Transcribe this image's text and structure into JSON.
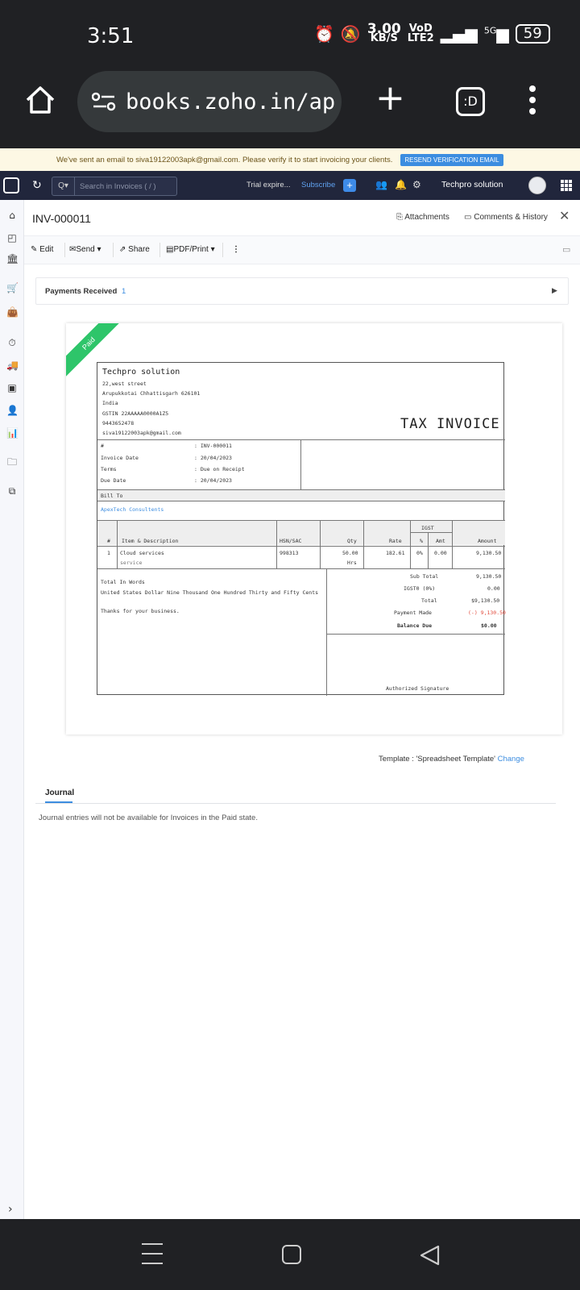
{
  "status_bar": {
    "time": "3:51",
    "net_speed_value": "3.00",
    "net_speed_unit": "KB/S",
    "vo_label": "VoD",
    "lte_label": "LTE2",
    "fiveg_label": "5G",
    "battery": "59"
  },
  "browser": {
    "url": "books.zoho.in/ap"
  },
  "banner": {
    "message": "We've sent an email to siva19122003apk@gmail.com. Please verify it to start invoicing your clients.",
    "resend_label": "RESEND VERIFICATION EMAIL"
  },
  "app_header": {
    "search_placeholder": "Search in Invoices ( / )",
    "trial_text": "Trial expire...",
    "subscribe_label": "Subscribe",
    "org_name": "Techpro solution"
  },
  "invoice_header": {
    "title": "INV-000011",
    "attachments_label": "Attachments",
    "comments_label": "Comments & History"
  },
  "toolbar": {
    "edit_label": "Edit",
    "send_label": "Send",
    "share_label": "Share",
    "pdf_label": "PDF/Print"
  },
  "payments": {
    "label": "Payments Received",
    "count": "1"
  },
  "invoice": {
    "status_ribbon": "Paid",
    "company_name": "Techpro solution",
    "address_line1": "22,west street",
    "address_line2": "Arupukkotai Chhattisgarh 626101",
    "country": "India",
    "gstin": "GSTIN 22AAAAA0000A1Z5",
    "phone": "9443652478",
    "email": "siva19122003apk@gmail.com",
    "doc_title": "TAX INVOICE",
    "meta": [
      {
        "label": "#",
        "value": ": INV-000011"
      },
      {
        "label": "Invoice Date",
        "value": ": 20/04/2023"
      },
      {
        "label": "Terms",
        "value": ": Due on Receipt"
      },
      {
        "label": "Due Date",
        "value": ": 20/04/2023"
      }
    ],
    "bill_to_label": "Bill To",
    "customer": "ApexTech Consultents",
    "table_headers": {
      "num": "#",
      "item": "Item & Description",
      "hsn": "HSN/SAC",
      "qty": "Qty",
      "rate": "Rate",
      "igst": "IGST",
      "pct": "%",
      "amt": "Amt",
      "amount": "Amount"
    },
    "line_items": [
      {
        "num": "1",
        "item": "Cloud services",
        "desc": "service",
        "hsn": "998313",
        "qty": "50.00",
        "unit": "Hrs",
        "rate": "182.61",
        "pct": "0%",
        "tax_amt": "0.00",
        "amount": "9,130.50"
      }
    ],
    "total_in_words_label": "Total In Words",
    "total_in_words": "United States Dollar Nine Thousand One Hundred Thirty and Fifty Cents",
    "thanks": "Thanks for your business.",
    "totals": [
      {
        "label": "Sub Total",
        "value": "9,130.50"
      },
      {
        "label": "IGST0 (0%)",
        "value": "0.00"
      },
      {
        "label": "Total",
        "value": "$9,130.50"
      },
      {
        "label": "Payment Made",
        "value": "(-) 9,130.50"
      },
      {
        "label": "Balance Due",
        "value": "$0.00"
      }
    ],
    "signature_label": "Authorized Signature"
  },
  "template": {
    "prefix": "Template : 'Spreadsheet Template'",
    "change_label": "Change"
  },
  "journal": {
    "tab_label": "Journal",
    "message": "Journal entries will not be available for Invoices in the Paid state."
  }
}
